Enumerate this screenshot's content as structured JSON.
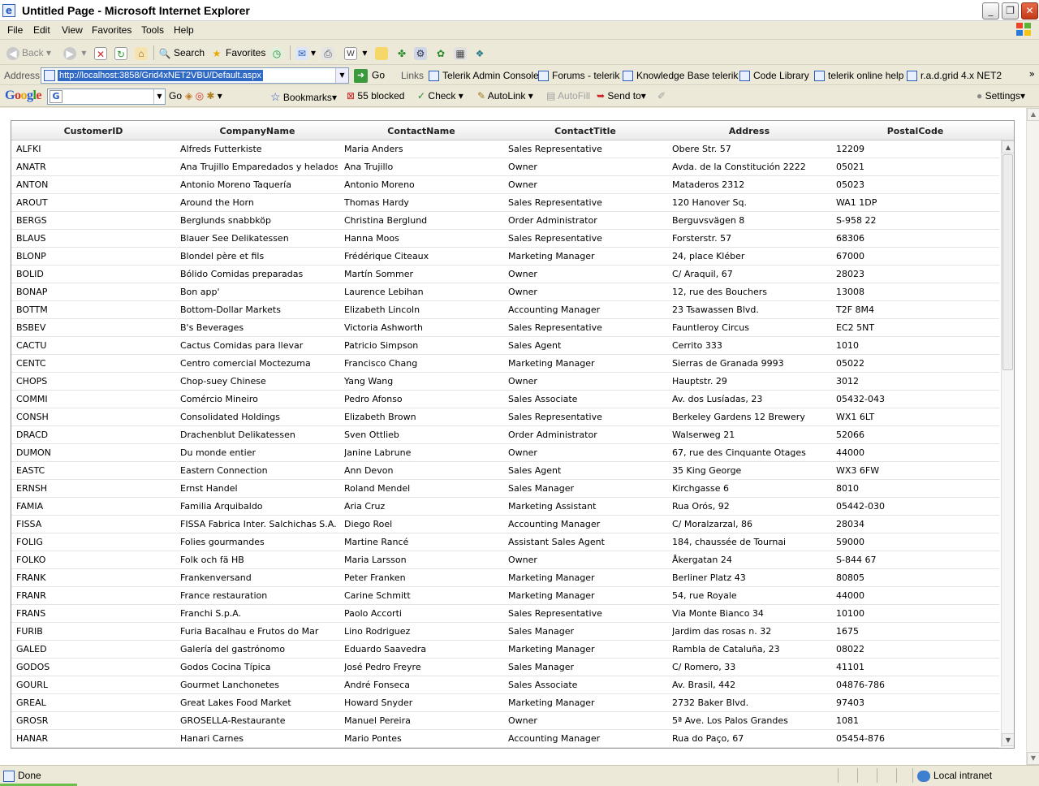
{
  "window": {
    "title": "Untitled Page - Microsoft Internet Explorer"
  },
  "menu": [
    "File",
    "Edit",
    "View",
    "Favorites",
    "Tools",
    "Help"
  ],
  "toolbar": {
    "back": "Back",
    "search": "Search",
    "favorites": "Favorites"
  },
  "address": {
    "label": "Address",
    "url": "http://localhost:3858/Grid4xNET2VBU/Default.aspx",
    "go": "Go",
    "links_label": "Links",
    "links": [
      "Telerik Admin Console",
      "Forums - telerik",
      "Knowledge Base  telerik",
      "Code Library",
      "telerik online help",
      "r.a.d.grid 4.x NET2"
    ]
  },
  "google": {
    "logo": "Google",
    "go": "Go",
    "bookmarks": "Bookmarks",
    "blocked": "55 blocked",
    "check": "Check",
    "autolink": "AutoLink",
    "autofill": "AutoFill",
    "sendto": "Send to",
    "settings": "Settings"
  },
  "grid": {
    "columns": [
      "CustomerID",
      "CompanyName",
      "ContactName",
      "ContactTitle",
      "Address",
      "PostalCode"
    ],
    "rows": [
      [
        "ALFKI",
        "Alfreds Futterkiste",
        "Maria Anders",
        "Sales Representative",
        "Obere Str. 57",
        "12209"
      ],
      [
        "ANATR",
        "Ana Trujillo Emparedados y helados",
        "Ana Trujillo",
        "Owner",
        "Avda. de la Constitución 2222",
        "05021"
      ],
      [
        "ANTON",
        "Antonio Moreno Taquería",
        "Antonio Moreno",
        "Owner",
        "Mataderos 2312",
        "05023"
      ],
      [
        "AROUT",
        "Around the Horn",
        "Thomas Hardy",
        "Sales Representative",
        "120 Hanover Sq.",
        "WA1 1DP"
      ],
      [
        "BERGS",
        "Berglunds snabbköp",
        "Christina Berglund",
        "Order Administrator",
        "Berguvsvägen 8",
        "S-958 22"
      ],
      [
        "BLAUS",
        "Blauer See Delikatessen",
        "Hanna Moos",
        "Sales Representative",
        "Forsterstr. 57",
        "68306"
      ],
      [
        "BLONP",
        "Blondel père et fils",
        "Frédérique Citeaux",
        "Marketing Manager",
        "24, place Kléber",
        "67000"
      ],
      [
        "BOLID",
        "Bólido Comidas preparadas",
        "Martín Sommer",
        "Owner",
        "C/ Araquil, 67",
        "28023"
      ],
      [
        "BONAP",
        "Bon app'",
        "Laurence Lebihan",
        "Owner",
        "12, rue des Bouchers",
        "13008"
      ],
      [
        "BOTTM",
        "Bottom-Dollar Markets",
        "Elizabeth Lincoln",
        "Accounting Manager",
        "23 Tsawassen Blvd.",
        "T2F 8M4"
      ],
      [
        "BSBEV",
        "B's Beverages",
        "Victoria Ashworth",
        "Sales Representative",
        "Fauntleroy Circus",
        "EC2 5NT"
      ],
      [
        "CACTU",
        "Cactus Comidas para llevar",
        "Patricio Simpson",
        "Sales Agent",
        "Cerrito 333",
        "1010"
      ],
      [
        "CENTC",
        "Centro comercial Moctezuma",
        "Francisco Chang",
        "Marketing Manager",
        "Sierras de Granada 9993",
        "05022"
      ],
      [
        "CHOPS",
        "Chop-suey Chinese",
        "Yang Wang",
        "Owner",
        "Hauptstr. 29",
        "3012"
      ],
      [
        "COMMI",
        "Comércio Mineiro",
        "Pedro Afonso",
        "Sales Associate",
        "Av. dos Lusíadas, 23",
        "05432-043"
      ],
      [
        "CONSH",
        "Consolidated Holdings",
        "Elizabeth Brown",
        "Sales Representative",
        "Berkeley Gardens 12 Brewery",
        "WX1 6LT"
      ],
      [
        "DRACD",
        "Drachenblut Delikatessen",
        "Sven Ottlieb",
        "Order Administrator",
        "Walserweg 21",
        "52066"
      ],
      [
        "DUMON",
        "Du monde entier",
        "Janine Labrune",
        "Owner",
        "67, rue des Cinquante Otages",
        "44000"
      ],
      [
        "EASTC",
        "Eastern Connection",
        "Ann Devon",
        "Sales Agent",
        "35 King George",
        "WX3 6FW"
      ],
      [
        "ERNSH",
        "Ernst Handel",
        "Roland Mendel",
        "Sales Manager",
        "Kirchgasse 6",
        "8010"
      ],
      [
        "FAMIA",
        "Familia Arquibaldo",
        "Aria Cruz",
        "Marketing Assistant",
        "Rua Orós, 92",
        "05442-030"
      ],
      [
        "FISSA",
        "FISSA Fabrica Inter. Salchichas S.A.",
        "Diego Roel",
        "Accounting Manager",
        "C/ Moralzarzal, 86",
        "28034"
      ],
      [
        "FOLIG",
        "Folies gourmandes",
        "Martine Rancé",
        "Assistant Sales Agent",
        "184, chaussée de Tournai",
        "59000"
      ],
      [
        "FOLKO",
        "Folk och fä HB",
        "Maria Larsson",
        "Owner",
        "Åkergatan 24",
        "S-844 67"
      ],
      [
        "FRANK",
        "Frankenversand",
        "Peter Franken",
        "Marketing Manager",
        "Berliner Platz 43",
        "80805"
      ],
      [
        "FRANR",
        "France restauration",
        "Carine Schmitt",
        "Marketing Manager",
        "54, rue Royale",
        "44000"
      ],
      [
        "FRANS",
        "Franchi S.p.A.",
        "Paolo Accorti",
        "Sales Representative",
        "Via Monte Bianco 34",
        "10100"
      ],
      [
        "FURIB",
        "Furia Bacalhau e Frutos do Mar",
        "Lino Rodriguez",
        "Sales Manager",
        "Jardim das rosas n. 32",
        "1675"
      ],
      [
        "GALED",
        "Galería del gastrónomo",
        "Eduardo Saavedra",
        "Marketing Manager",
        "Rambla de Cataluña, 23",
        "08022"
      ],
      [
        "GODOS",
        "Godos Cocina Típica",
        "José Pedro Freyre",
        "Sales Manager",
        "C/ Romero, 33",
        "41101"
      ],
      [
        "GOURL",
        "Gourmet Lanchonetes",
        "André Fonseca",
        "Sales Associate",
        "Av. Brasil, 442",
        "04876-786"
      ],
      [
        "GREAL",
        "Great Lakes Food Market",
        "Howard Snyder",
        "Marketing Manager",
        "2732 Baker Blvd.",
        "97403"
      ],
      [
        "GROSR",
        "GROSELLA-Restaurante",
        "Manuel Pereira",
        "Owner",
        "5ª Ave. Los Palos Grandes",
        "1081"
      ],
      [
        "HANAR",
        "Hanari Carnes",
        "Mario Pontes",
        "Accounting Manager",
        "Rua do Paço, 67",
        "05454-876"
      ]
    ]
  },
  "status": {
    "text": "Done",
    "zone": "Local intranet"
  }
}
